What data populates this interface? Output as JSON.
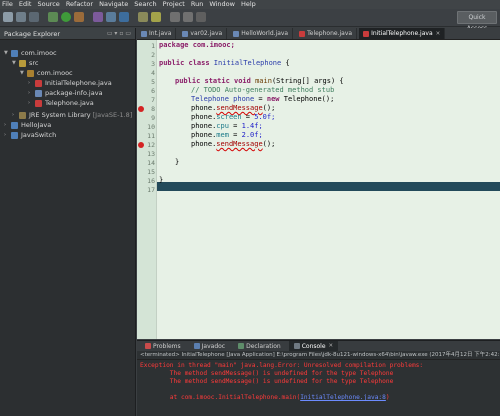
{
  "menu": [
    "File",
    "Edit",
    "Source",
    "Refactor",
    "Navigate",
    "Search",
    "Project",
    "Run",
    "Window",
    "Help"
  ],
  "quick_access": "Quick Access",
  "package_explorer": {
    "title": "Package Explorer",
    "tree": [
      {
        "label": "com.imooc",
        "indent": 0
      },
      {
        "label": "src",
        "indent": 1
      },
      {
        "label": "com.imooc",
        "indent": 2
      },
      {
        "label": "InitialTelephone.java",
        "indent": 3
      },
      {
        "label": "package-info.java",
        "indent": 3
      },
      {
        "label": "Telephone.java",
        "indent": 3
      },
      {
        "label": "JRE System Library",
        "extra": "[JavaSE-1.8]",
        "indent": 1
      },
      {
        "label": "HelloJava",
        "indent": 0
      },
      {
        "label": "JavaSwitch",
        "indent": 0
      }
    ]
  },
  "editor_tabs": [
    {
      "label": "Int.java"
    },
    {
      "label": "var02.java"
    },
    {
      "label": "HelloWorld.java"
    },
    {
      "label": "Telephone.java"
    },
    {
      "label": "InitialTelephone.java",
      "active": true
    }
  ],
  "code": {
    "line1": "package com.imooc;",
    "line3a": "public class ",
    "line3b": "InitialTelephone ",
    "line3c": "{",
    "line5a": "public static void ",
    "line5b": "main",
    "line5c": "(String[] args) {",
    "line6": "// TODO Auto-generated method stub",
    "line7a": "Telephone phone",
    "line7b": " = ",
    "line7c": "new ",
    "line7d": "Telephone();",
    "line8a": "phone.",
    "line8b": "sendMessage",
    "line8c": "();",
    "line9a": "phone.",
    "line9b": "screen",
    "line9c": " = ",
    "line9d": "5.0f;",
    "line10a": "phone.",
    "line10b": "cpu",
    "line10c": " = ",
    "line10d": "1.4f;",
    "line11a": "phone.",
    "line11b": "mem",
    "line11c": " = ",
    "line11d": "2.0f;",
    "line12a": "phone.",
    "line12b": "sendMessage",
    "line12c": "();",
    "line14": "}",
    "line16": "}"
  },
  "line_numbers": [
    "1",
    "2",
    "3",
    "4",
    "5",
    "6",
    "7",
    "8",
    "9",
    "10",
    "11",
    "12",
    "13",
    "14",
    "15",
    "16",
    "17"
  ],
  "bottom_tabs": [
    {
      "label": "Problems"
    },
    {
      "label": "Javadoc"
    },
    {
      "label": "Declaration"
    },
    {
      "label": "Console",
      "active": true
    }
  ],
  "console": {
    "header": "<terminated> InitialTelephone [Java Application] E:\\program Files\\jdk-8u121-windows-x64\\bin\\javaw.exe (2017年4月12日 下午2:42:13)",
    "line1": "Exception in thread \"main\" java.lang.Error: Unresolved compilation problems:",
    "line2": "        The method sendMessage() is undefined for the type Telephone",
    "line3": "        The method sendMessage() is undefined for the type Telephone",
    "line4a": "        at com.imooc.InitialTelephone.main(",
    "line4b": "InitialTelephone.java:8",
    "line4c": ")"
  }
}
